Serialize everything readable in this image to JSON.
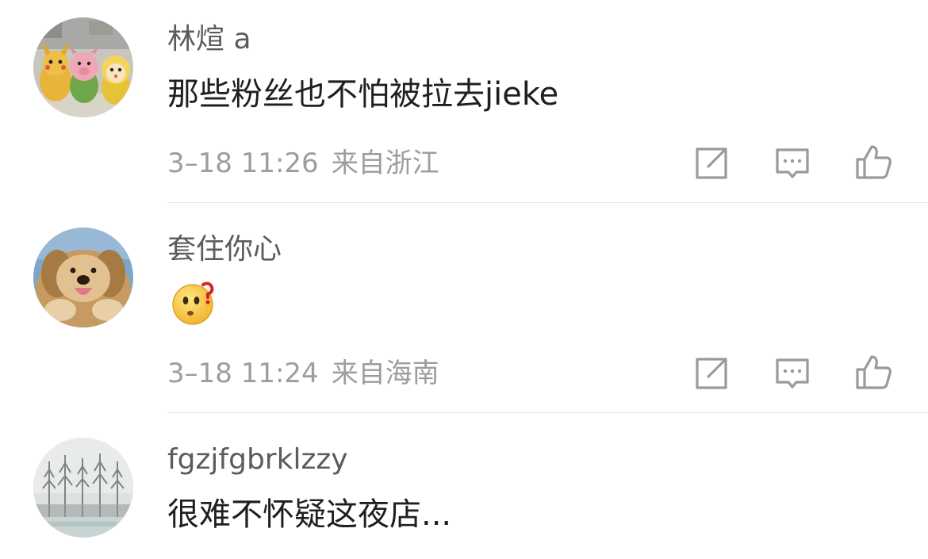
{
  "comments": [
    {
      "username": "林煊 a",
      "content": "那些粉丝也不怕被拉去jieke",
      "time": "3–18 11:26",
      "location": "来自浙江",
      "avatar_icon": "plush-toys-avatar"
    },
    {
      "username": "套住你心",
      "content_icon": "thinking-face-emoji",
      "time": "3–18 11:24",
      "location": "来自海南",
      "avatar_icon": "puppy-avatar"
    },
    {
      "username": "fgzjfgbrklzzy",
      "content": "很难不怀疑这夜店...",
      "avatar_icon": "winter-trees-avatar"
    }
  ],
  "actions": {
    "icons": [
      "share-icon",
      "comment-icon",
      "like-icon"
    ],
    "icon_color": "#9a9a9a"
  },
  "colors": {
    "username": "#5b5b5b",
    "content": "#1f1f1f",
    "meta": "#9d9d9d",
    "divider": "#e6e6e6"
  }
}
